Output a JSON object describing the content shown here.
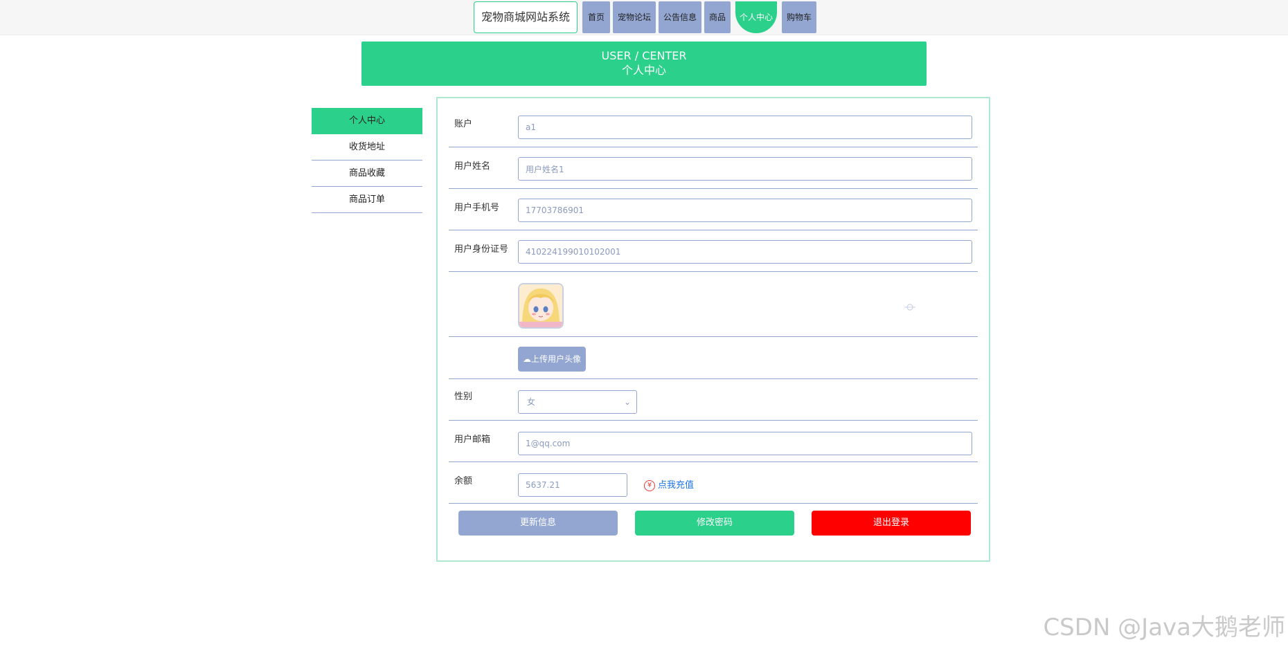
{
  "header": {
    "brand": "宠物商城网站系统",
    "nav": [
      {
        "label": "首页"
      },
      {
        "label": "宠物论坛"
      },
      {
        "label": "公告信息"
      },
      {
        "label": "商品"
      },
      {
        "label": "个人中心",
        "active": true
      },
      {
        "label": "购物车"
      }
    ]
  },
  "banner": {
    "en": "USER / CENTER",
    "zh": "个人中心"
  },
  "sidebar": {
    "items": [
      {
        "label": "个人中心",
        "active": true
      },
      {
        "label": "收货地址"
      },
      {
        "label": "商品收藏"
      },
      {
        "label": "商品订单"
      }
    ]
  },
  "form": {
    "account": {
      "label": "账户",
      "value": "a1"
    },
    "name": {
      "label": "用户姓名",
      "value": "用户姓名1"
    },
    "phone": {
      "label": "用户手机号",
      "value": "17703786901"
    },
    "idcard": {
      "label": "用户身份证号",
      "value": "410224199010102001"
    },
    "upload_label": "上传用户头像",
    "gender": {
      "label": "性别",
      "value": "女"
    },
    "email": {
      "label": "用户邮箱",
      "value": "1@qq.com"
    },
    "balance": {
      "label": "余额",
      "value": "5637.21",
      "recharge": "点我充值"
    }
  },
  "actions": {
    "update": "更新信息",
    "password": "修改密码",
    "logout": "退出登录"
  },
  "colors": {
    "accent": "#2bd08a",
    "nav": "#93a6d1",
    "danger": "#ff0000"
  },
  "watermark": "CSDN @Java大鹅老师"
}
